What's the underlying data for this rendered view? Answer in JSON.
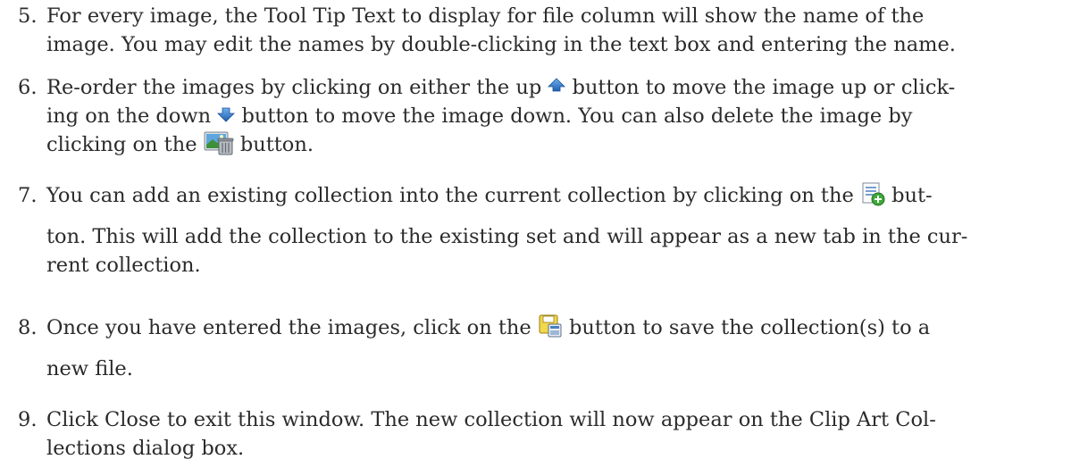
{
  "items": [
    {
      "number": "5.",
      "lines": [
        "For every image, the Tool Tip Text to display for file column will show the name of the",
        "image. You may edit the names by double-clicking in the text box and entering the name."
      ]
    },
    {
      "number": "6.",
      "line1_a": "Re-order the images by clicking on either the up ",
      "line1_b": " button to move the image up or click-",
      "line2_a": "ing on the down ",
      "line2_b": " button to move the image down. You can also delete the image by",
      "line3_a": "clicking on the ",
      "line3_b": " button.",
      "icons": [
        "up-arrow-icon",
        "down-arrow-icon",
        "delete-image-icon"
      ]
    },
    {
      "number": "7.",
      "line1_a": "You can add an existing collection into the current collection by clicking on the ",
      "line1_b": " but-",
      "line2": "ton. This will add the collection to the existing set and will appear as a new tab in the cur-",
      "line3": "rent collection.",
      "icons": [
        "add-collection-icon"
      ]
    },
    {
      "number": "8.",
      "line1_a": "Once you have entered the images, click on the ",
      "line1_b": " button to save the collection(s) to a",
      "line2": "new file.",
      "icons": [
        "save-collection-icon"
      ]
    },
    {
      "number": "9.",
      "lines": [
        "Click Close to exit this window. The new collection will now appear on the Clip Art Col-",
        "lections dialog box."
      ]
    }
  ]
}
